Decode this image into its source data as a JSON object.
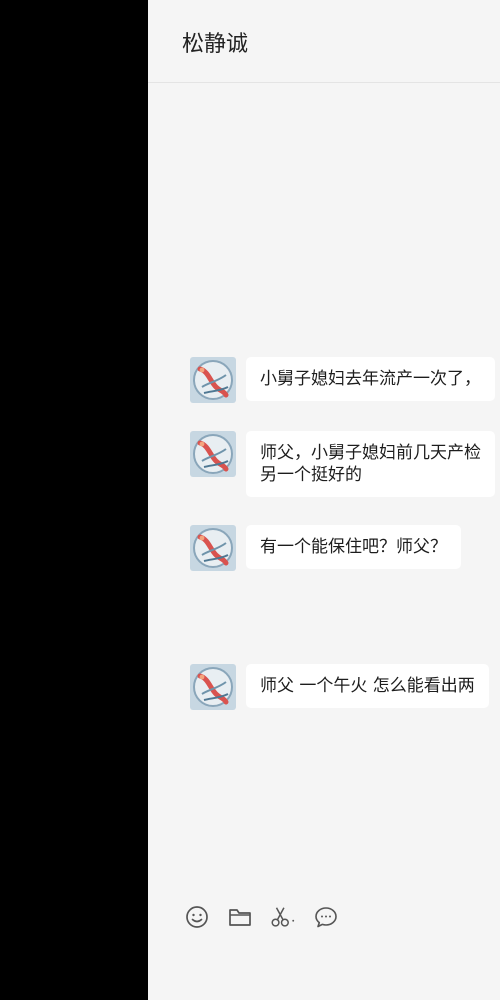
{
  "window": {
    "title": "松静诚"
  },
  "messages": [
    {
      "lines": [
        "小舅子媳妇去年流产一次了，"
      ]
    },
    {
      "lines": [
        "师父，小舅子媳妇前几天产检",
        "另一个挺好的"
      ]
    },
    {
      "lines": [
        "有一个能保住吧？师父？"
      ]
    },
    {
      "lines": [
        "师父 一个午火 怎么能看出两"
      ]
    }
  ],
  "toolbar": {
    "icons": [
      "emoji-icon",
      "folder-icon",
      "scissors-icon",
      "chat-bubble-icon"
    ]
  }
}
